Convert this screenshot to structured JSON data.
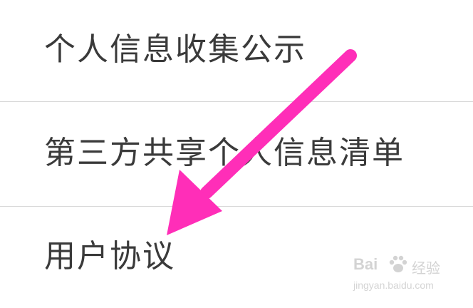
{
  "menu": {
    "items": [
      {
        "label": "个人信息收集公示"
      },
      {
        "label": "第三方共享个人信息清单"
      },
      {
        "label": "用户协议"
      }
    ]
  },
  "annotation": {
    "arrow_color": "#ff2eb8",
    "points_to": "用户协议"
  },
  "watermark": {
    "brand": "Bai",
    "brand_cn": "经验",
    "site": "jingyan.baidu.com",
    "icon": "paw-icon"
  },
  "colors": {
    "text": "#3a3a3a",
    "divider": "#d8d8d8",
    "background": "#ffffff"
  }
}
